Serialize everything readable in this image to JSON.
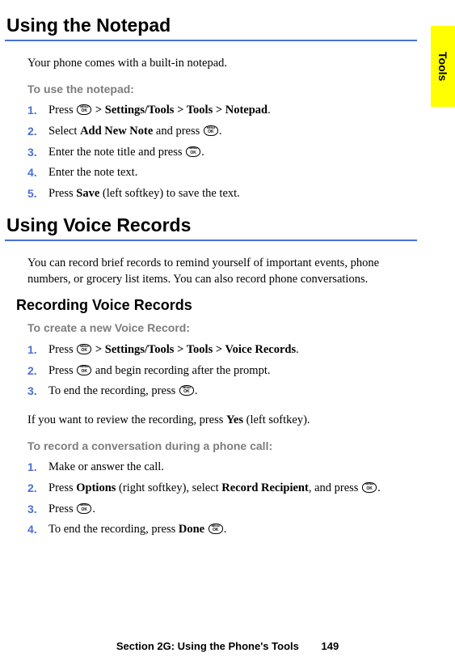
{
  "sideTab": "Tools",
  "heading1": "Using the Notepad",
  "intro1": "Your phone comes with a built-in notepad.",
  "leadin1": "To use the notepad:",
  "steps1": {
    "s1_a": "Press ",
    "s1_b": " > Settings/Tools > Tools > Notepad",
    "s1_c": ".",
    "s2_a": "Select ",
    "s2_b": "Add New Note",
    "s2_c": " and press ",
    "s2_d": ".",
    "s3_a": "Enter the note title and press ",
    "s3_b": ".",
    "s4": "Enter the note text.",
    "s5_a": "Press ",
    "s5_b": "Save",
    "s5_c": " (left softkey) to save the text."
  },
  "heading2": "Using Voice Records",
  "intro2": "You can record brief records to remind yourself of important events, phone numbers, or grocery list items. You can also record phone conversations.",
  "subheading": "Recording Voice Records",
  "leadin2": "To create a new Voice Record:",
  "steps2": {
    "s1_a": "Press ",
    "s1_b": " > Settings/Tools > Tools > Voice Records",
    "s1_c": ".",
    "s2_a": "Press ",
    "s2_b": " and begin recording after the prompt.",
    "s3_a": "To end the recording, press ",
    "s3_b": "."
  },
  "review_a": "If you want to review the recording, press ",
  "review_b": "Yes",
  "review_c": " (left softkey).",
  "leadin3": "To record a conversation during a phone call:",
  "steps3": {
    "s1": "Make or answer the call.",
    "s2_a": "Press ",
    "s2_b": "Options",
    "s2_c": " (right softkey), select ",
    "s2_d": "Record Recipient",
    "s2_e": ", and press ",
    "s2_f": ".",
    "s3_a": "Press ",
    "s3_b": ".",
    "s4_a": "To end the recording, press ",
    "s4_b": "Done",
    "s4_c": " ",
    "s4_d": "."
  },
  "footer_section": "Section 2G: Using the Phone's Tools",
  "footer_page": "149",
  "nums": {
    "n1": "1.",
    "n2": "2.",
    "n3": "3.",
    "n4": "4.",
    "n5": "5."
  }
}
